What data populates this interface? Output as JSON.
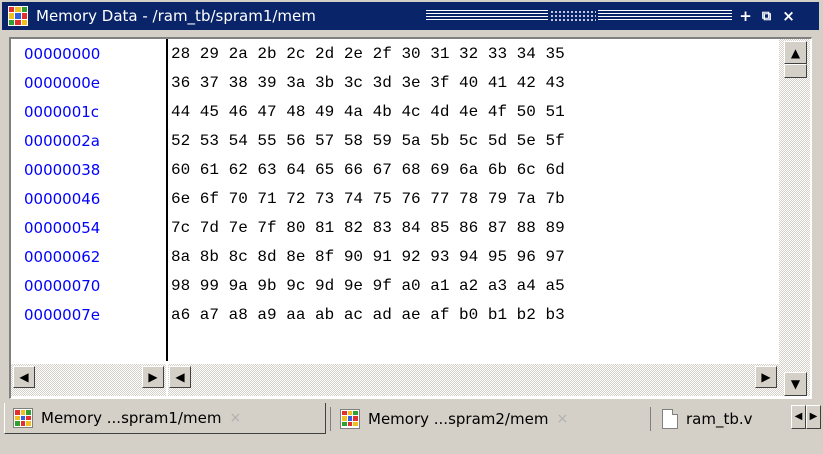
{
  "window": {
    "title": "Memory Data - /ram_tb/spram1/mem"
  },
  "memory": {
    "rows": [
      {
        "address": "00000000",
        "bytes": "28 29 2a 2b 2c 2d 2e 2f 30 31 32 33 34 35"
      },
      {
        "address": "0000000e",
        "bytes": "36 37 38 39 3a 3b 3c 3d 3e 3f 40 41 42 43"
      },
      {
        "address": "0000001c",
        "bytes": "44 45 46 47 48 49 4a 4b 4c 4d 4e 4f 50 51"
      },
      {
        "address": "0000002a",
        "bytes": "52 53 54 55 56 57 58 59 5a 5b 5c 5d 5e 5f"
      },
      {
        "address": "00000038",
        "bytes": "60 61 62 63 64 65 66 67 68 69 6a 6b 6c 6d"
      },
      {
        "address": "00000046",
        "bytes": "6e 6f 70 71 72 73 74 75 76 77 78 79 7a 7b"
      },
      {
        "address": "00000054",
        "bytes": "7c 7d 7e 7f 80 81 82 83 84 85 86 87 88 89"
      },
      {
        "address": "00000062",
        "bytes": "8a 8b 8c 8d 8e 8f 90 91 92 93 94 95 96 97"
      },
      {
        "address": "00000070",
        "bytes": "98 99 9a 9b 9c 9d 9e 9f a0 a1 a2 a3 a4 a5"
      },
      {
        "address": "0000007e",
        "bytes": "a6 a7 a8 a9 aa ab ac ad ae af b0 b1 b2 b3"
      }
    ]
  },
  "tabs": [
    {
      "label": "Memory ...spram1/mem",
      "close": "×"
    },
    {
      "label": "Memory ...spram2/mem",
      "close": "×"
    },
    {
      "label": "ram_tb.v"
    }
  ],
  "icons": {
    "maximize": "+",
    "undock": "⧉",
    "close": "×",
    "left": "◀",
    "right": "▶",
    "up": "▲",
    "down": "▼"
  },
  "colors": {
    "titlebar": "#0a246a",
    "address": "#0000ff"
  }
}
